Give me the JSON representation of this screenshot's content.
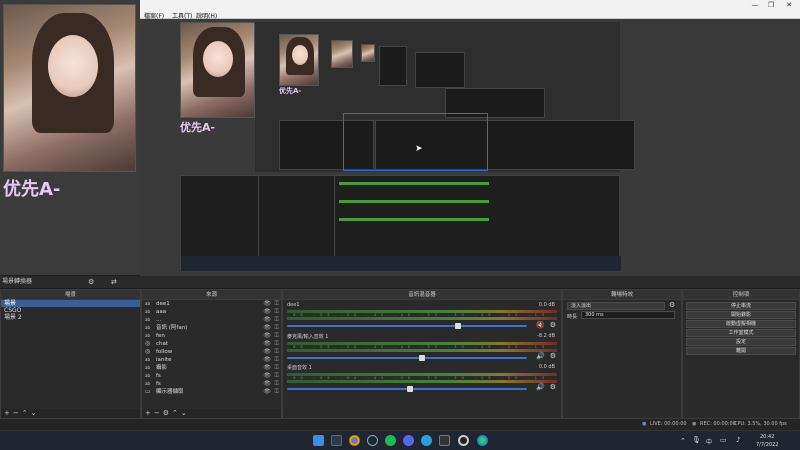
{
  "window": {
    "menu": [
      "檔案(F)",
      "工具(T)",
      "說明(H)"
    ],
    "controls": [
      "—",
      "❐",
      "✕"
    ]
  },
  "overlay": {
    "caption_large": "优先A-",
    "caption_small": "优先A-",
    "caption_tiny": "优先A-"
  },
  "docks": {
    "scene_transitions_label": "場景轉換器",
    "scenes": {
      "title": "場景",
      "items": [
        "場景",
        "CSGO",
        "場景 2"
      ],
      "selected": 0
    },
    "sources": {
      "title": "來源",
      "items": [
        {
          "label": "dee1",
          "icon": "text-icon"
        },
        {
          "label": "aaa",
          "icon": "text-icon"
        },
        {
          "label": "...",
          "icon": "text-icon"
        },
        {
          "label": "音訊 (阿fan)",
          "icon": "text-icon"
        },
        {
          "label": "fen",
          "icon": "text-icon"
        },
        {
          "label": "chat",
          "icon": "browser-icon"
        },
        {
          "label": "follow",
          "icon": "browser-icon"
        },
        {
          "label": "ianite",
          "icon": "text-icon"
        },
        {
          "label": "攝影",
          "icon": "text-icon"
        },
        {
          "label": "fs",
          "icon": "text-icon"
        },
        {
          "label": "fs",
          "icon": "text-icon"
        },
        {
          "label": "顯示器擷取",
          "icon": "monitor-icon"
        }
      ]
    },
    "mixer": {
      "title": "音訊混音器",
      "channels": [
        {
          "name": "dee1",
          "db": "0.0 dB",
          "level": 0.7,
          "muted": true
        },
        {
          "name": "麥克風/輸入音效 1",
          "db": "-8.2 dB",
          "level": 0.55,
          "muted": false
        },
        {
          "name": "桌面音效 1",
          "db": "0.0 dB",
          "level": 0.5,
          "muted": false
        }
      ]
    },
    "transitions": {
      "title": "轉場特效",
      "type": "淡入淡出",
      "duration_label": "時長",
      "duration_value": "300 ms"
    },
    "controls": {
      "title": "控制項",
      "buttons": [
        "停止串流",
        "開始錄影",
        "啟動虛擬相機",
        "工作室模式",
        "設定",
        "離開"
      ]
    }
  },
  "status": {
    "live": "LIVE: 00:00:00",
    "rec": "REC: 00:00:00",
    "cpu": "CPU: 3.5%, 30.00 fps"
  },
  "taskbar": {
    "clock_time": "20:42",
    "clock_date": "7/7/2022",
    "lang": "中",
    "icons": [
      "windows-start-icon",
      "file-explorer-icon",
      "chrome-icon",
      "steam-icon",
      "spotify-icon",
      "discord-icon",
      "telegram-icon",
      "video-app-icon",
      "obs-icon",
      "edge-icon"
    ]
  },
  "colors": {
    "accent": "#3a5f93",
    "overlay_text": "#e6c8f2",
    "meter_green": "#4d9a3a",
    "mute_red": "#d33"
  }
}
